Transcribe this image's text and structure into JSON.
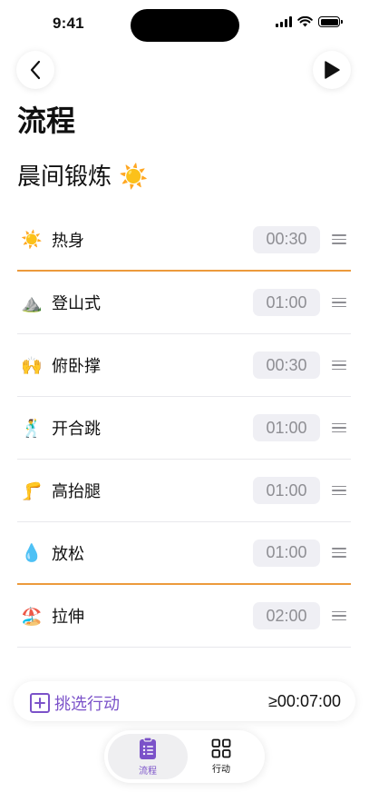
{
  "status_bar": {
    "time": "9:41"
  },
  "nav": {
    "back_icon": "chevron-left-icon",
    "play_icon": "play-icon"
  },
  "page": {
    "title": "流程",
    "routine_title": "晨间锻炼 ☀️"
  },
  "steps": [
    {
      "emoji": "☀️",
      "label": "热身",
      "duration": "00:30"
    },
    {
      "emoji": "⛰️",
      "label": "登山式",
      "duration": "01:00"
    },
    {
      "emoji": "🙌",
      "label": "俯卧撑",
      "duration": "00:30"
    },
    {
      "emoji": "🕺",
      "label": "开合跳",
      "duration": "01:00"
    },
    {
      "emoji": "🦵",
      "label": "高抬腿",
      "duration": "01:00"
    },
    {
      "emoji": "💧",
      "label": "放松",
      "duration": "01:00"
    },
    {
      "emoji": "🏖️",
      "label": "拉伸",
      "duration": "02:00"
    }
  ],
  "action_bar": {
    "pick_label": "挑选行动",
    "total_time": "≥00:07:00"
  },
  "tabbar": {
    "tabs": [
      {
        "label": "流程",
        "icon": "clipboard-list-icon",
        "active": true
      },
      {
        "label": "行动",
        "icon": "grid-icon",
        "active": false
      }
    ]
  },
  "colors": {
    "accent": "#7b52c9",
    "separator_orange": "#ec9a3c",
    "pill_bg": "#efeff4"
  }
}
